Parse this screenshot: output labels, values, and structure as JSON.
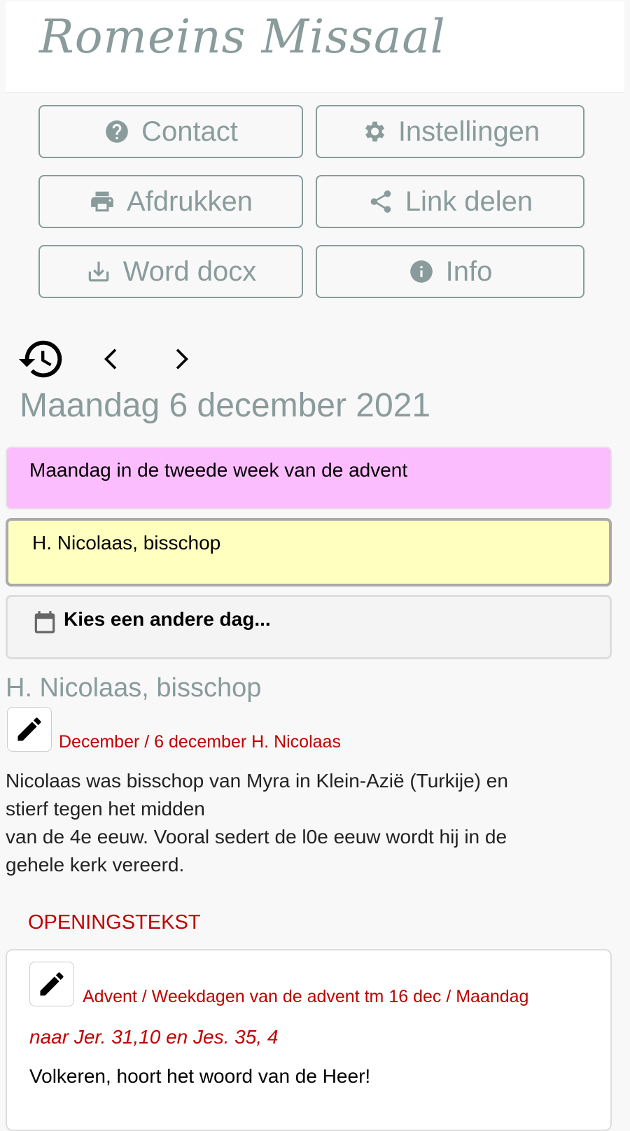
{
  "header": {
    "logo_text": "Romeins Missaal"
  },
  "buttons": [
    {
      "label": "Contact",
      "icon": "help-circle-icon"
    },
    {
      "label": "Instellingen",
      "icon": "gear-icon"
    },
    {
      "label": "Afdrukken",
      "icon": "printer-icon"
    },
    {
      "label": "Link delen",
      "icon": "share-icon"
    },
    {
      "label": "Word docx",
      "icon": "download-icon"
    },
    {
      "label": "Info",
      "icon": "info-icon"
    }
  ],
  "date_title": "Maandag 6 december 2021",
  "day_options": [
    {
      "label": "Maandag in de tweede week van de advent",
      "color": "#fbbdfd"
    },
    {
      "label": "H. Nicolaas, bisschop",
      "color": "#ffffc0",
      "selected": true
    }
  ],
  "choose_day": "Kies een andere dag...",
  "feast": {
    "title": "H. Nicolaas, bisschop",
    "path": "December / 6 december H. Nicolaas",
    "description_lines": [
      "Nicolaas was bisschop van Myra in Klein-Azië (Turkije) en",
      "stierf tegen het midden",
      "van de 4e eeuw. Vooral sedert de l0e eeuw wordt hij in de",
      "gehele kerk vereerd."
    ]
  },
  "section": {
    "heading": "OPENINGSTEKST",
    "path": "Advent / Weekdagen van de advent tm 16 dec / Maandag",
    "reference": "naar Jer. 31,10 en Jes. 35, 4",
    "text": "Volkeren, hoort het woord van de Heer!"
  }
}
